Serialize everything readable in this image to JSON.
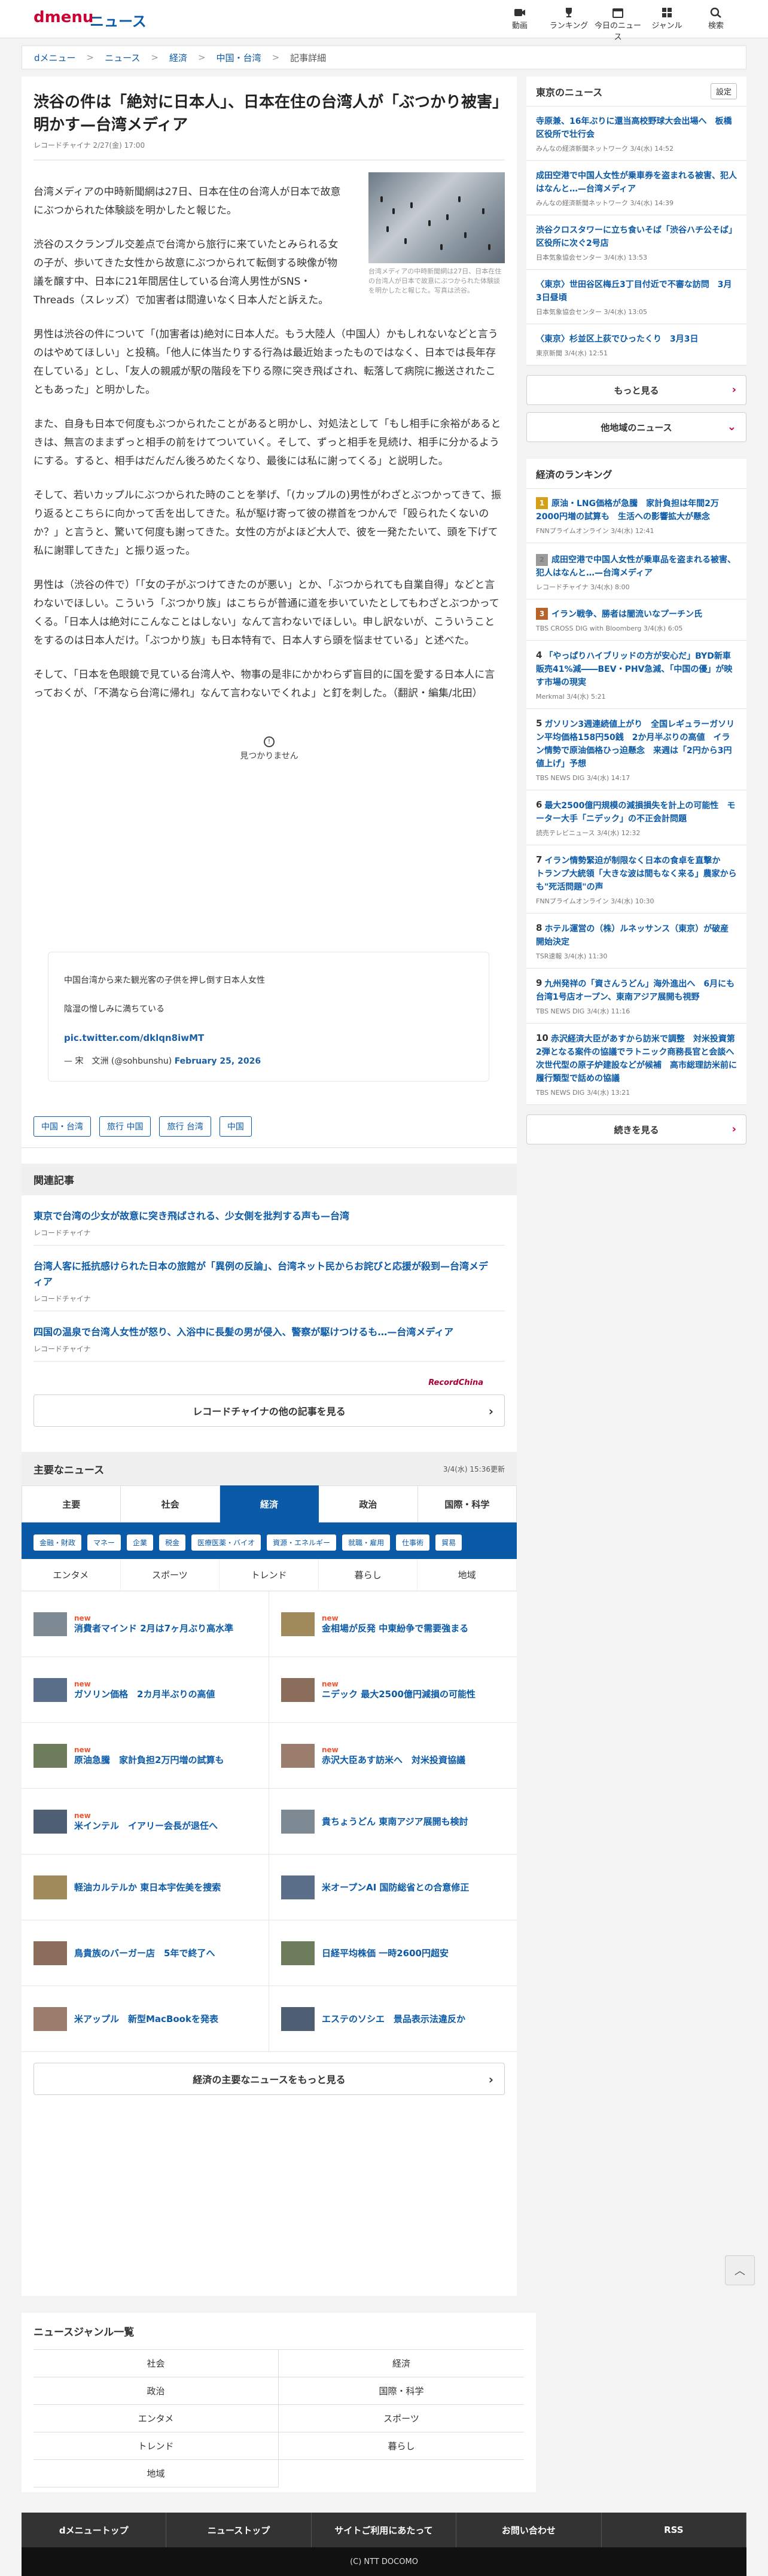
{
  "header": {
    "logo": "dmenu",
    "logo_sub": "ニュース",
    "nav": [
      {
        "label": "動画",
        "icon": "video-icon"
      },
      {
        "label": "ランキング",
        "icon": "trophy-icon"
      },
      {
        "label": "今日のニュース",
        "icon": "calendar-icon"
      },
      {
        "label": "ジャンル",
        "icon": "grid-icon"
      },
      {
        "label": "検索",
        "icon": "search-icon"
      }
    ]
  },
  "breadcrumb": [
    "dメニュー",
    "ニュース",
    "経済",
    "中国・台湾",
    "記事詳細"
  ],
  "article": {
    "title": "渋谷の件は「絶対に日本人」、日本在住の台湾人が「ぶつかり被害」明かす—台湾メディア",
    "meta": "レコードチャイナ 2/27(金) 17:00",
    "photo_caption": "台湾メディアの中時新聞網は27日、日本在住の台湾人が日本で故意にぶつかられた体験談を明かしたと報じた。写真は渋谷。",
    "p1": "台湾メディアの中時新聞網は27日、日本在住の台湾人が日本で故意にぶつかられた体験談を明かしたと報じた。",
    "p2": "渋谷のスクランブル交差点で台湾から旅行に来ていたとみられる女の子が、歩いてきた女性から故意にぶつかられて転倒する映像が物議を醸す中、日本に21年間居住している台湾人男性がSNS・Threads（スレッズ）で加害者は間違いなく日本人だと訴えた。",
    "p3": "男性は渋谷の件について「(加害者は)絶対に日本人だ。もう大陸人（中国人）かもしれないなどと言うのはやめてほしい」と投稿。「他人に体当たりする行為は最近始まったものではなく、日本では長年存在している」とし、「友人の親戚が駅の階段を下りる際に突き飛ばされ、転落して病院に搬送されたこともあった」と明かした。",
    "p4": "また、自身も日本で何度もぶつかられたことがあると明かし、対処法として「もし相手に余裕があるときは、無言のままずっと相手の前をけてついていく。そして、ずっと相手を見続け、相手に分かるようにする。すると、相手はだんだん後ろめたくなり、最後には私に謝ってくる」と説明した。",
    "p5": "そして、若いカップルにぶつかられた時のことを挙げ、「(カップルの)男性がわざとぶつかってきて、振り返るとこちらに向かって舌を出してきた。私が駆け寄って彼の襟首をつかんで「殴られたくないのか？」と言うと、驚いて何度も謝ってきた。女性の方がよほど大人で、彼を一発たたいて、頭を下げて私に謝罪してきた」と振り返った。",
    "p6": "男性は（渋谷の件で）「「女の子がぶつけてきたのが悪い」とか、「ぶつかられても自業自得」などと言わないでほしい。こういう「ぶつかり族」はこちらが普通に道を歩いていたとしてもわざとぶつかってくる。「日本人は絶対にこんなことはしない」なんて言わないでほしい。申し訳ないが、こういうことをするのは日本人だけ。「ぶつかり族」も日本特有で、日本人すら頭を悩ませている」と述べた。",
    "p7": "そして、「日本を色眼鏡で見ている台湾人や、物事の是非にかかわらず盲目的に国を愛する日本人に言っておくが、「不満なら台湾に帰れ」なんて言わないでくれよ」と釘を刺した。（翻訳・編集/北田）",
    "video_unavailable": "見つかりません"
  },
  "tweet": {
    "line1": "中国台湾から来た観光客の子供を押し倒す日本人女性",
    "line2": "陰湿の憎しみに満ちている",
    "link": "pic.twitter.com/dklqn8iwMT",
    "by_prefix": "— 宋　文洲 (@sohbunshu)",
    "date": "February 25, 2026"
  },
  "tags": [
    "中国・台湾",
    "旅行 中国",
    "旅行 台湾",
    "中国"
  ],
  "related": {
    "heading": "関連記事",
    "items": [
      {
        "title": "東京で台湾の少女が故意に突き飛ばされる、少女側を批判する声も—台湾",
        "source": "レコードチャイナ"
      },
      {
        "title": "台湾人客に抵抗感けられた日本の旅館が「異例の反論」、台湾ネット民からお詫びと応援が殺到—台湾メディア",
        "source": "レコードチャイナ"
      },
      {
        "title": "四国の温泉で台湾人女性が怒り、入浴中に長髪の男が侵入、警察が駆けつけるも…—台湾メディア",
        "source": "レコードチャイナ"
      }
    ],
    "logo": "RecordChina",
    "more": "レコードチャイナの他の記事を見る"
  },
  "main_news": {
    "heading": "主要なニュース",
    "updated": "3/4(水) 15:36更新",
    "tabs": [
      "主要",
      "社会",
      "経済",
      "政治",
      "国際・科学"
    ],
    "active_tab": 2,
    "subtabs": [
      "金融・財政",
      "マネー",
      "企業",
      "税金",
      "医療医薬・バイオ",
      "資源・エネルギー",
      "就職・雇用",
      "仕事術",
      "貿易"
    ],
    "tabs2": [
      "エンタメ",
      "スポーツ",
      "トレンド",
      "暮らし",
      "地域"
    ],
    "new_label": "new",
    "items": [
      {
        "title": "消費者マインド 2月は7ヶ月ぶり高水準",
        "new": true
      },
      {
        "title": "金相場が反発 中東紛争で需要強まる",
        "new": true
      },
      {
        "title": "ガソリン価格　2カ月半ぶりの高値",
        "new": true
      },
      {
        "title": "ニデック 最大2500億円減損の可能性",
        "new": true
      },
      {
        "title": "原油急騰　家計負担2万円増の試算も",
        "new": true
      },
      {
        "title": "赤沢大臣あす訪米へ　対米投資協議",
        "new": true
      },
      {
        "title": "米インテル　イアリー会長が退任へ",
        "new": true
      },
      {
        "title": "貴ちょうどん 東南アジア展開も検討",
        "new": false
      },
      {
        "title": "軽油カルテルか 東日本宇佐美を捜索",
        "new": false
      },
      {
        "title": "米オープンAI 国防総省との合意修正",
        "new": false
      },
      {
        "title": "鳥貴族のバーガー店　5年で終了へ",
        "new": false
      },
      {
        "title": "日経平均株価 一時2600円超安",
        "new": false
      },
      {
        "title": "米アップル　新型MacBookを発表",
        "new": false
      },
      {
        "title": "エステのソシエ　景品表示法違反か",
        "new": false
      }
    ],
    "more": "経済の主要なニュースをもっと見る"
  },
  "genres": {
    "heading": "ニュースジャンル一覧",
    "items": [
      "社会",
      "経済",
      "政治",
      "国際・科学",
      "エンタメ",
      "スポーツ",
      "トレンド",
      "暮らし",
      "地域"
    ]
  },
  "footer": {
    "links": [
      "dメニュートップ",
      "ニューストップ",
      "サイトご利用にあたって",
      "お問い合わせ",
      "RSS"
    ],
    "copyright": "(C) NTT DOCOMO"
  },
  "sidebar": {
    "tokyo": {
      "heading": "東京のニュース",
      "setting": "設定",
      "items": [
        {
          "title": "寺原兼、16年ぶりに還当高校野球大会出場へ　板橋区役所で壮行会",
          "source": "みんなの経済新聞ネットワーク 3/4(水) 14:52"
        },
        {
          "title": "成田空港で中国人女性が乗車券を盗まれる被害、犯人はなんと…—台湾メディア",
          "source": "みんなの経済新聞ネットワーク 3/4(水) 14:39"
        },
        {
          "title": "渋谷クロスタワーに立ち食いそば「渋谷ハチ公そば」　区役所に次ぐ2号店",
          "source": "日本気象協会センター 3/4(水) 13:53"
        },
        {
          "title": "〈東京〉世田谷区梅丘3丁目付近で不審な訪問　3月3日昼頃",
          "source": "日本気象協会センター 3/4(水) 13:05"
        },
        {
          "title": "〈東京〉杉並区上荻でひったくり　3月3日",
          "source": "東京新聞 3/4(水) 12:51"
        }
      ],
      "more": "もっと見る",
      "other": "他地域のニュース"
    },
    "ranking": {
      "heading": "経済のランキング",
      "items": [
        {
          "n": "1",
          "title": "原油・LNG価格が急騰　家計負担は年間2万2000円増の試算も　生活への影響拡大が懸念",
          "source": "FNNプライムオンライン 3/4(水) 12:41"
        },
        {
          "n": "2",
          "title": "成田空港で中国人女性が乗車品を盗まれる被害、犯人はなんと…—台湾メディア",
          "source": "レコードチャイナ 3/4(水) 8:00"
        },
        {
          "n": "3",
          "title": "イラン戦争、勝者は闇流いなプーチン氏",
          "source": "TBS CROSS DIG with Bloomberg 3/4(水) 6:05"
        },
        {
          "n": "4",
          "title": "「やっぱりハイブリッドの方が安心だ」BYD新車販売41%減――BEV・PHV急減、「中国の優」が映す市場の現実",
          "source": "Merkmal 3/4(水) 5:21"
        },
        {
          "n": "5",
          "title": "ガソリン3週連続値上がり　全国レギュラーガソリン平均価格158円50銭　2か月半ぶりの高値　イラン情勢で原油価格ひっ迫懸念　来週は「2円から3円値上げ」予想",
          "source": "TBS NEWS DIG 3/4(水) 14:17"
        },
        {
          "n": "6",
          "title": "最大2500億円規模の減損損失を計上の可能性　モーター大手「ニデック」の不正会計問題",
          "source": "読売テレビニュース 3/4(水) 12:32"
        },
        {
          "n": "7",
          "title": "イラン情勢緊迫が制限なく日本の食卓を直撃か　トランプ大統領「大きな波は間もなく来る」農家からも\"死活問題\"の声",
          "source": "FNNプライムオンライン 3/4(水) 10:30"
        },
        {
          "n": "8",
          "title": "ホテル運営の（株）ルネッサンス（東京）が破産開始決定",
          "source": "TSR速報 3/4(水) 11:30"
        },
        {
          "n": "9",
          "title": "九州発祥の「資さんうどん」海外進出へ　6月にも台湾1号店オープン、東南アジア展開も視野",
          "source": "TBS NEWS DIG 3/4(水) 11:16"
        },
        {
          "n": "10",
          "title": "赤沢経済大臣があすから訪米で調整　対米投資第2弾となる案件の協議でラトニック商務長官と会談へ　次世代型の原子炉建設などが候補　高市総理訪米前に履行類型で話めの協議",
          "source": "TBS NEWS DIG 3/4(水) 13:21"
        }
      ],
      "more": "続きを見る"
    }
  },
  "colors": {
    "brand_red": "#cc0033",
    "brand_blue": "#0b5aa8"
  }
}
